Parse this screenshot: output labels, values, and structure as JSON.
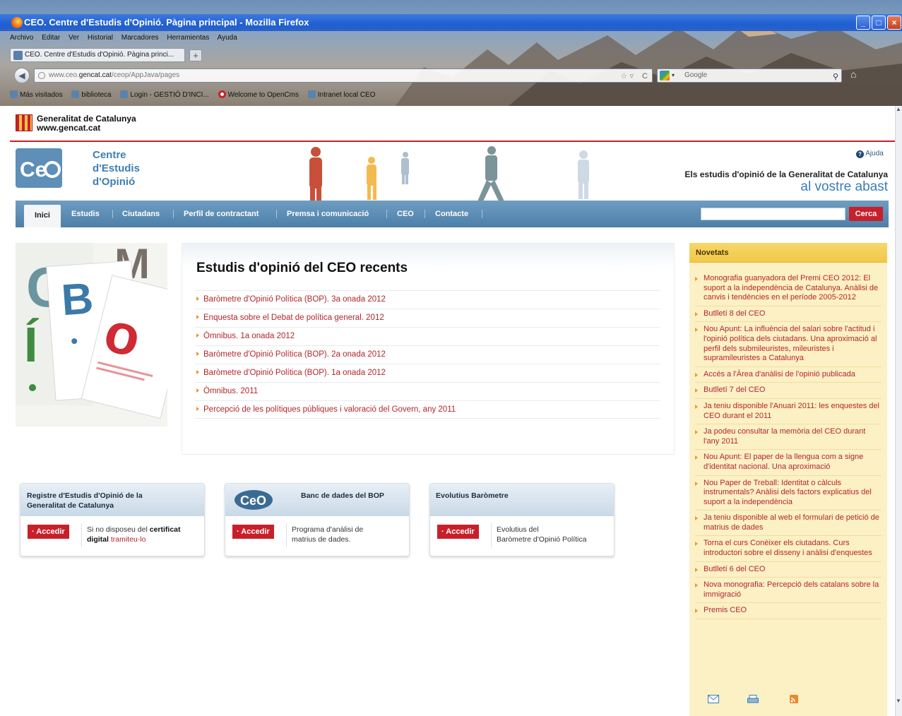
{
  "window": {
    "title": "CEO. Centre d'Estudis d'Opinió. Pàgina principal - Mozilla Firefox"
  },
  "menu": [
    "Archivo",
    "Editar",
    "Ver",
    "Historial",
    "Marcadores",
    "Herramientas",
    "Ayuda"
  ],
  "tab": {
    "label": "CEO. Centre d'Estudis d'Opinió. Pàgina princi...",
    "new_tab": "+"
  },
  "address": {
    "prefix": "www.ceo.",
    "domain": "gencat.cat",
    "path": "/ceop/AppJava/pages"
  },
  "search_engine": {
    "placeholder": "Google"
  },
  "bookmarks": [
    "Más visitados",
    "biblioteca",
    "Login - GESTIÓ D'INCI...",
    "Welcome to OpenCms",
    "Intranet local CEO"
  ],
  "gencat": {
    "line1": "Generalitat de Catalunya",
    "line2": "www.gencat.cat"
  },
  "ceo": {
    "line1": "Centre",
    "line2": "d'Estudis",
    "line3": "d'Opinió"
  },
  "help": "Ajuda",
  "tagline": {
    "line1": "Els estudis d'opinió de la Generalitat de Catalunya",
    "line2": "al vostre abast"
  },
  "nav": {
    "items": [
      "Inici",
      "Estudis",
      "Ciutadans",
      "Perfil de contractant",
      "Premsa i comunicació",
      "CEO",
      "Contacte"
    ],
    "search_button": "Cerca"
  },
  "recent": {
    "title": "Estudis d'opinió del CEO recents",
    "items": [
      "Baròmetre d'Opinió Política (BOP). 3a onada 2012",
      "Enquesta sobre el Debat de política general. 2012",
      "Òmnibus. 1a onada 2012",
      "Baròmetre d'Opinió Política (BOP). 2a onada 2012",
      "Baròmetre d'Opinió Política (BOP). 1a onada 2012",
      "Òmnibus. 2011",
      "Percepció de les polítiques públiques i valoració del Govern, any 2011"
    ]
  },
  "boxes": [
    {
      "title": "Registre d'Estudis d'Opinió de la Generalitat de Catalunya",
      "button": "· Accedir",
      "text1": "Si no disposeu del ",
      "text_bold": "certificat digital",
      "text_link": " tramiteu-lo"
    },
    {
      "title": "Banc de dades del BOP",
      "button": "· Accedir",
      "text1": "Programa d'anàlisi de",
      "text2": "matrius de dades."
    },
    {
      "title": "Evolutius Baròmetre",
      "button": "· Accedir",
      "text1": "Evolutius del",
      "text2": "Baròmetre d'Opinió Política"
    }
  ],
  "novetats": {
    "title": "Novetats",
    "items": [
      "Monografia guanyadora del Premi CEO 2012: El suport a la independència de Catalunya. Anàlisi de canvis i tendències en el període 2005-2012",
      "Butlletí 8 del CEO",
      "Nou Apunt: La influència del salari sobre l'actitud i l'opinió política dels ciutadans. Una aproximació al perfil dels submileuristes, mileuristes i supramileuristes a Catalunya",
      "Accés a l'Àrea d'anàlisi de l'opinió publicada",
      "Butlletí 7 del CEO",
      "Ja teniu disponible l'Anuari 2011: les enquestes del CEO durant el 2011",
      "Ja podeu consultar la memòria del CEO durant l'any 2011",
      "Nou Apunt: El paper de la llengua com a signe d'identitat nacional. Una aproximació",
      "Nou Paper de Treball: Identitat o càlculs instrumentals? Anàlisi dels factors explicatius del suport a la independència",
      "Ja teniu disponible al web el formulari de petició de matrius de dades",
      "Torna el curs Conèixer els ciutadans. Curs introductori sobre el disseny i anàlisi d'enquestes",
      "Butlletí 6 del CEO",
      "Nova monografia: Percepció dels catalans sobre la immigració",
      "Premis CEO"
    ]
  },
  "colors": {
    "accent_red": "#c8202a",
    "nav_blue": "#4d7fa9",
    "ceo_blue": "#3f7fb3",
    "novetats_bg": "#fcf0c5"
  }
}
